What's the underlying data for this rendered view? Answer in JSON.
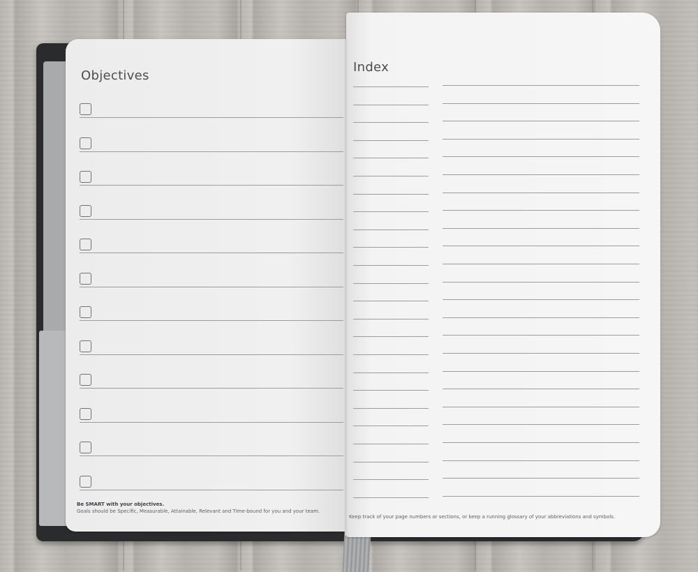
{
  "left_page": {
    "title": "Objectives",
    "objective_rows": 12,
    "footer_heading": "Be SMART with your objectives.",
    "footer_text": "Goals should be Specific, Measurable, Attainable, Relevant and Time-bound for you and your team."
  },
  "right_page": {
    "title": "Index",
    "index_rows": 24,
    "footer_text": "Keep track of your page numbers or sections, or keep a running glossary of your abbreviations and symbols."
  },
  "colors": {
    "cover": "#2a2b2d",
    "paper": "#f1f1f1",
    "rule_line": "#9a9c9f",
    "text": "#4a4c50"
  }
}
